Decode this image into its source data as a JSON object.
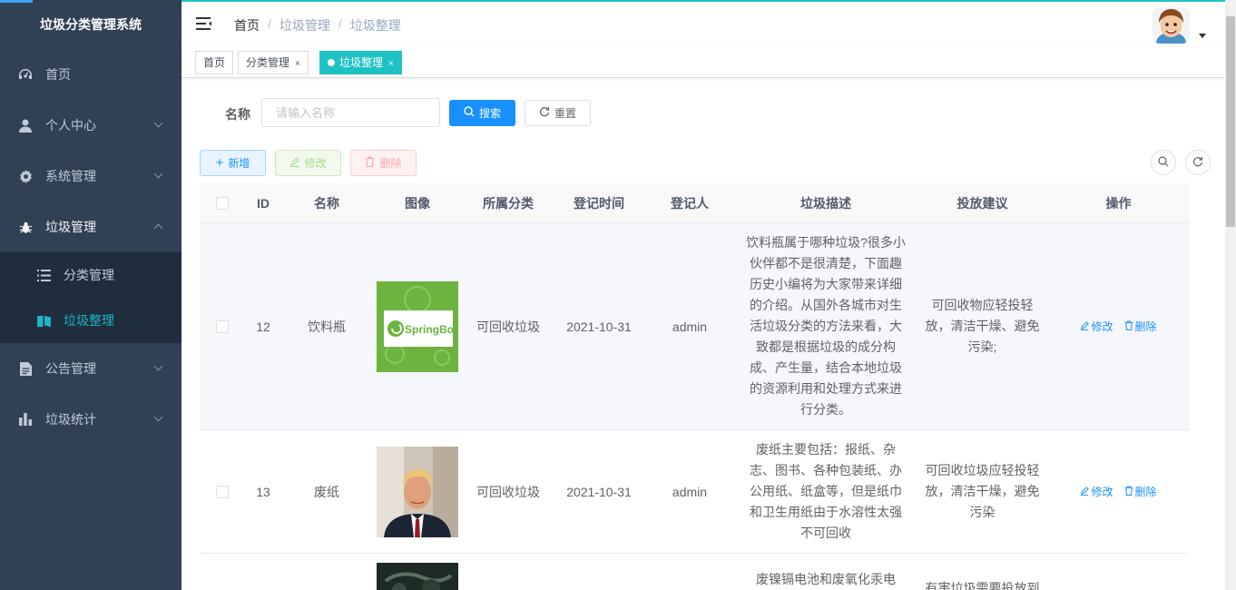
{
  "sidebar": {
    "title": "垃圾分类管理系统",
    "items": [
      {
        "label": "首页"
      },
      {
        "label": "个人中心"
      },
      {
        "label": "系统管理"
      },
      {
        "label": "垃圾管理"
      },
      {
        "label": "公告管理"
      },
      {
        "label": "垃圾统计"
      }
    ],
    "sub_items": [
      {
        "label": "分类管理"
      },
      {
        "label": "垃圾整理"
      }
    ]
  },
  "breadcrumb": [
    "首页",
    "垃圾管理",
    "垃圾整理"
  ],
  "tags": [
    {
      "label": "首页"
    },
    {
      "label": "分类管理",
      "close": "×"
    },
    {
      "label": "垃圾整理",
      "close": "×"
    }
  ],
  "search": {
    "label": "名称",
    "placeholder": "请输入名称",
    "search_button": "搜索",
    "reset_button": "重置"
  },
  "toolbar": {
    "add": "新增",
    "edit": "修改",
    "delete": "删除"
  },
  "table": {
    "headers": [
      "ID",
      "名称",
      "图像",
      "所属分类",
      "登记时间",
      "登记人",
      "垃圾描述",
      "投放建议",
      "操作"
    ],
    "edit_label": "修改",
    "delete_label": "删除",
    "rows": [
      {
        "id": "12",
        "name": "饮料瓶",
        "image_text": "SpringBoot",
        "category": "可回收垃圾",
        "time": "2021-10-31",
        "user": "admin",
        "desc": "饮料瓶属于哪种垃圾?很多小伙伴都不是很清楚，下面趣历史小编将为大家带来详细的介绍。从国外各城市对生活垃圾分类的方法来看，大致都是根据垃圾的成分构成、产生量，结合本地垃圾的资源利用和处理方式来进行分类。",
        "advice": "可回收物应轻投轻放，清洁干燥、避免污染;"
      },
      {
        "id": "13",
        "name": "废纸",
        "category": "可回收垃圾",
        "time": "2021-10-31",
        "user": "admin",
        "desc": "废纸主要包括：报纸、杂志、图书、各种包装纸、办公用纸、纸盒等，但是纸巾和卫生用纸由于水溶性太强不可回收",
        "advice": "可回收垃圾应轻投轻放，清洁干燥，避免污染"
      },
      {
        "desc": "废镍镉电池和废氧化汞电",
        "advice": "有害垃圾需要投放到"
      }
    ]
  },
  "colors": {
    "sidebar_bg": "#304156",
    "accent": "#1fc2c4",
    "primary": "#1890ff"
  }
}
